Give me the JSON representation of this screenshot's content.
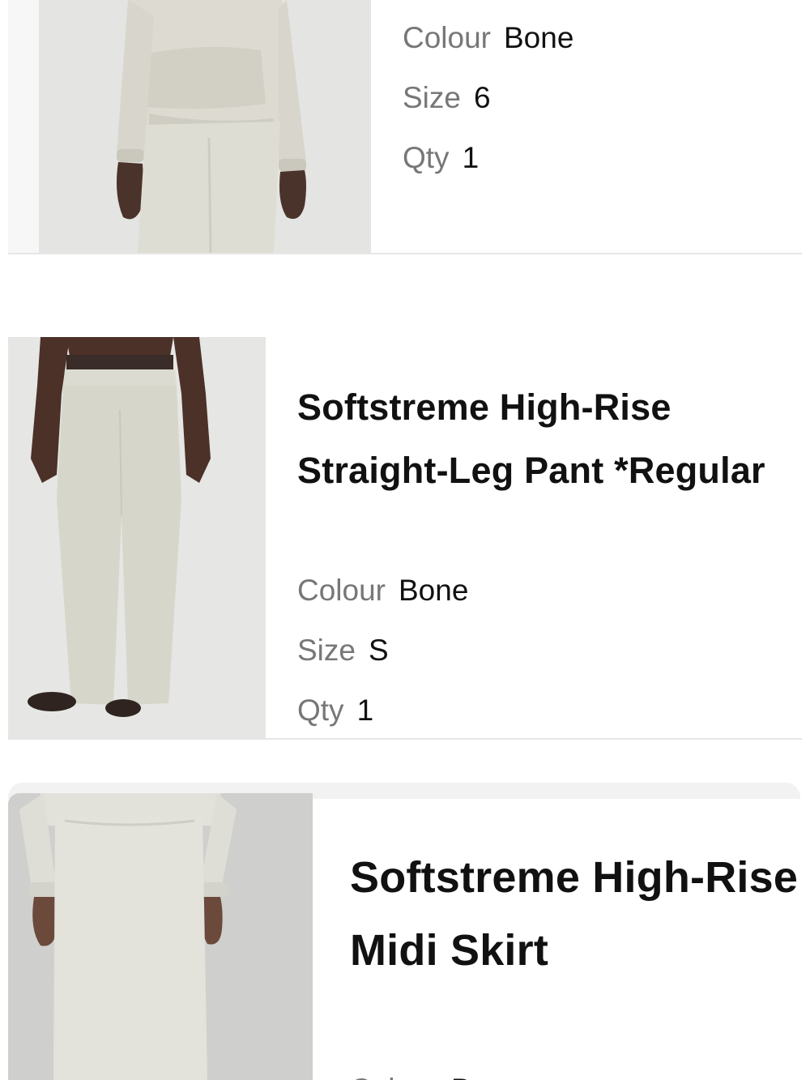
{
  "items": [
    {
      "title": "",
      "colour_label": "Colour",
      "colour_value": "Bone",
      "size_label": "Size",
      "size_value": "6",
      "qty_label": "Qty",
      "qty_value": "1"
    },
    {
      "title_line1": "Softstreme High-Rise",
      "title_line2": "Straight-Leg Pant *Regular",
      "colour_label": "Colour",
      "colour_value": "Bone",
      "size_label": "Size",
      "size_value": "S",
      "qty_label": "Qty",
      "qty_value": "1"
    },
    {
      "title_line1": "Softstreme High-Rise",
      "title_line2": "Midi Skirt",
      "colour_label": "Colour",
      "colour_value": "Bone"
    }
  ],
  "colors": {
    "background": "#ffffff",
    "label_gray": "#777777",
    "text": "#111111",
    "product_colour_bone": "#dcdad0",
    "divider": "#e6e6e6"
  },
  "icons": {
    "item_1_image": "product-photo-bone-half-zip-and-jogger",
    "item_2_image": "product-photo-bone-straight-leg-pant",
    "item_3_image": "product-photo-bone-midi-skirt"
  }
}
